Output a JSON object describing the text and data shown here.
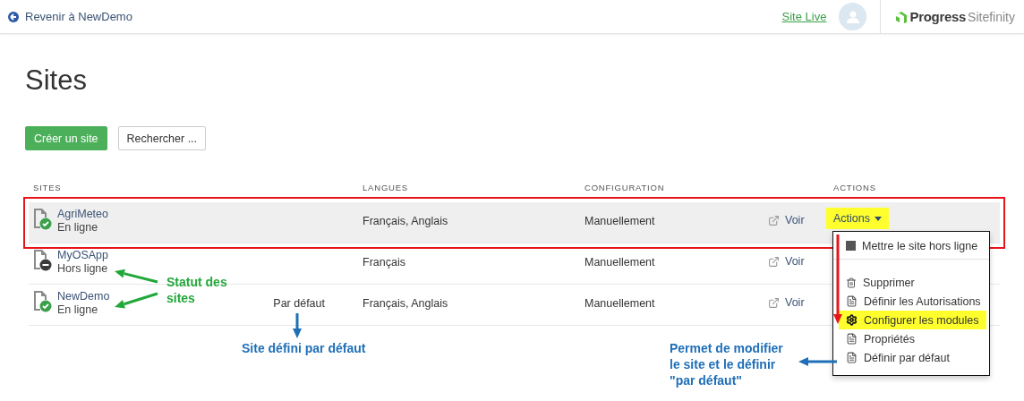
{
  "header": {
    "back_link": "Revenir à NewDemo",
    "site_live": "Site Live",
    "logo": {
      "brand": "Progress",
      "product": "Sitefinity"
    }
  },
  "title": "Sites",
  "buttons": [
    {
      "label": "Créer un site",
      "kind": "primary"
    },
    {
      "label": "Rechercher ...",
      "kind": "secondary"
    }
  ],
  "table": {
    "columns": [
      "SITES",
      "LANGUES",
      "CONFIGURATION",
      "ACTIONS"
    ],
    "rows": [
      {
        "name": "AgriMeteo",
        "status": "En ligne",
        "online": true,
        "languages": "Français, Anglais",
        "configuration": "Manuellement",
        "view": "Voir",
        "actions": {
          "label": "Actions",
          "expanded": true,
          "highlighted": true
        },
        "selected": true,
        "outlined": true
      },
      {
        "name": "MyOSApp",
        "status": "Hors ligne",
        "online": false,
        "languages": "Français",
        "configuration": "Manuellement",
        "view": "Voir",
        "selected": false,
        "outlined": false
      },
      {
        "name": "NewDemo",
        "status": "En ligne",
        "online": true,
        "default": "Par défaut",
        "languages": "Français, Anglais",
        "configuration": "Manuellement",
        "view": "Voir",
        "selected": false,
        "outlined": false
      }
    ]
  },
  "menu": {
    "groups": [
      [
        {
          "label": "Mettre le site hors ligne",
          "kind": "square",
          "highlighted": false
        }
      ],
      [
        {
          "label": "Supprimer",
          "kind": "trash",
          "highlighted": false
        },
        {
          "label": "Définir les Autorisations",
          "kind": "document",
          "highlighted": false
        },
        {
          "label": "Configurer les modules",
          "kind": "gear",
          "highlighted": true
        },
        {
          "label": "Propriétés",
          "kind": "document",
          "highlighted": false
        },
        {
          "label": "Définir par défaut",
          "kind": "document",
          "highlighted": false
        }
      ]
    ]
  },
  "annotations": {
    "status_note": "Statut des sites",
    "default_note": "Site défini par défaut",
    "edit_note": "Permet de modifier le site et le définir \"par défaut\""
  }
}
